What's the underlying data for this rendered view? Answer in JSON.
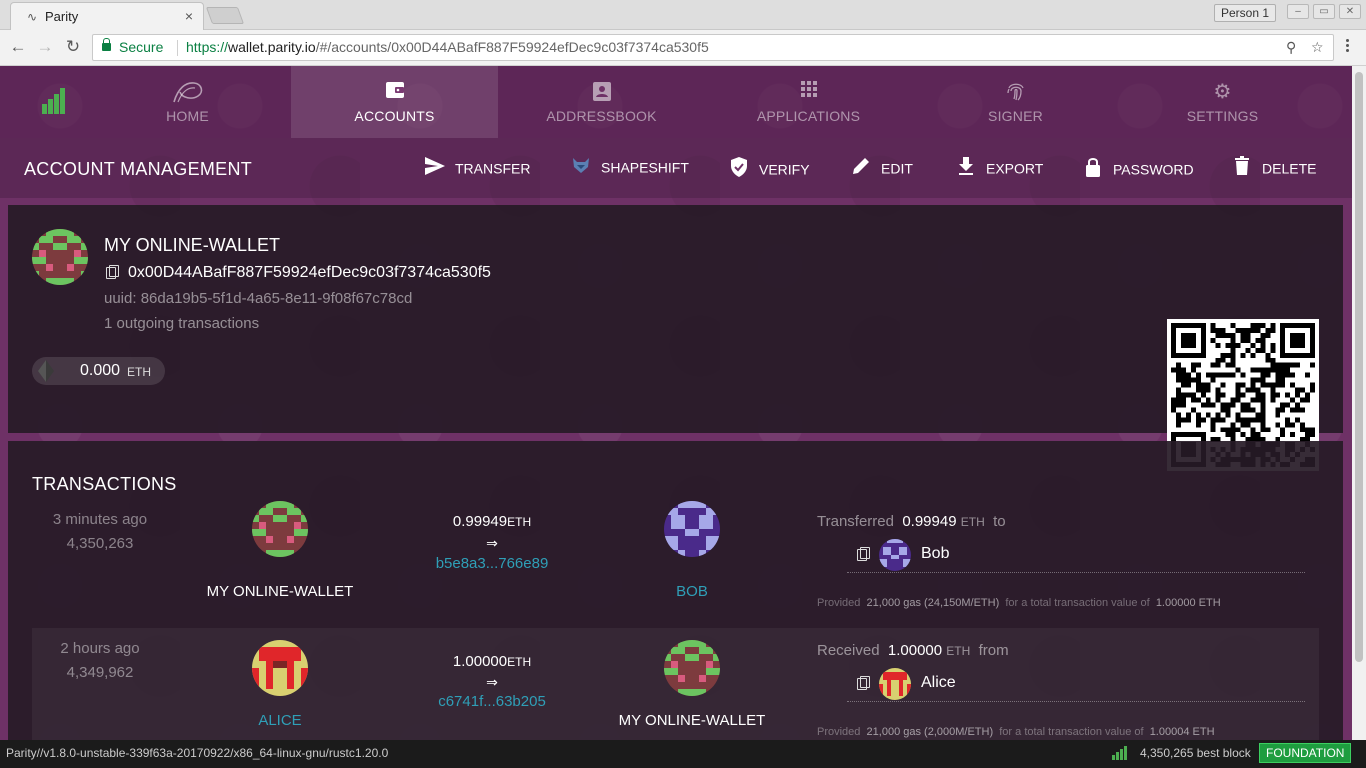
{
  "browser": {
    "tab_title": "Parity",
    "tab_close": "×",
    "profile": "Person 1",
    "secure_label": "Secure",
    "url_scheme": "https://",
    "url_host": "wallet.parity.io",
    "url_path": "/#/accounts/0x00D44ABafF887F59924efDec9c03f7374ca530f5",
    "nav_icons": [
      "back-icon",
      "forward-icon",
      "reload-icon"
    ]
  },
  "nav": {
    "tabs": [
      {
        "label": "HOME",
        "icon": "parity-logo-icon",
        "active": false
      },
      {
        "label": "ACCOUNTS",
        "icon": "wallet-icon",
        "active": true
      },
      {
        "label": "ADDRESSBOOK",
        "icon": "contacts-icon",
        "active": false
      },
      {
        "label": "APPLICATIONS",
        "icon": "apps-grid-icon",
        "active": false
      },
      {
        "label": "SIGNER",
        "icon": "fingerprint-icon",
        "active": false
      },
      {
        "label": "SETTINGS",
        "icon": "gear-icon",
        "active": false
      }
    ]
  },
  "actions": {
    "heading": "ACCOUNT MANAGEMENT",
    "buttons": [
      {
        "label": "TRANSFER",
        "icon": "send-icon"
      },
      {
        "label": "SHAPESHIFT",
        "icon": "fox-icon"
      },
      {
        "label": "VERIFY",
        "icon": "shield-check-icon"
      },
      {
        "label": "EDIT",
        "icon": "pencil-icon"
      },
      {
        "label": "EXPORT",
        "icon": "download-icon"
      },
      {
        "label": "PASSWORD",
        "icon": "lock-icon"
      },
      {
        "label": "DELETE",
        "icon": "trash-icon"
      }
    ]
  },
  "account": {
    "name": "MY ONLINE-WALLET",
    "address": "0x00D44ABafF887F59924efDec9c03f7374ca530f5",
    "uuid": "uuid: 86da19b5-5f1d-4a65-8e11-9f08f67c78cd",
    "tx_count": "1 outgoing transactions",
    "balance": "0.000",
    "balance_unit": "ETH"
  },
  "transactions": {
    "heading": "TRANSACTIONS",
    "rows": [
      {
        "time": "3 minutes ago",
        "block": "4,350,263",
        "from": "MY ONLINE-WALLET",
        "amount": "0.99949",
        "unit": "ETH",
        "arrow": "⇒",
        "hash": "b5e8a3...766e89",
        "to": "BOB",
        "summary_prefix": "Transferred",
        "summary_value": "0.99949",
        "summary_unit": "ETH",
        "summary_suffix": "to",
        "party": "Bob",
        "provided_prefix": "Provided",
        "gas": "21,000 gas (24,150M/",
        "gas_unit": "ETH",
        "gas_close": ")",
        "total_text": "for a total transaction value of",
        "total": "1.00000",
        "total_unit": "ETH"
      },
      {
        "time": "2 hours ago",
        "block": "4,349,962",
        "from": "ALICE",
        "amount": "1.00000",
        "unit": "ETH",
        "arrow": "⇒",
        "hash": "c6741f...63b205",
        "to": "MY ONLINE-WALLET",
        "summary_prefix": "Received",
        "summary_value": "1.00000",
        "summary_unit": "ETH",
        "summary_suffix": "from",
        "party": "Alice",
        "provided_prefix": "Provided",
        "gas": "21,000 gas (2,000M/",
        "gas_unit": "ETH",
        "gas_close": ")",
        "total_text": "for a total transaction value of",
        "total": "1.00004",
        "total_unit": "ETH"
      }
    ]
  },
  "status": {
    "version": "Parity//v1.8.0-unstable-339f63a-20170922/x86_64-linux-gnu/rustc1.20.0",
    "block": "4,350,265 best block",
    "chain": "FOUNDATION"
  },
  "colors": {
    "accent_link": "#2f9fb7",
    "secure_green": "#0b8043",
    "chain_badge": "#1e9d3f"
  }
}
